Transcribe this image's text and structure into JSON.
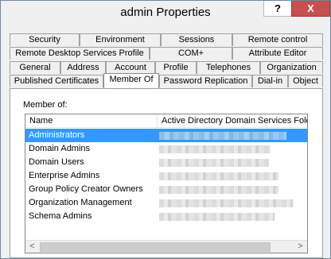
{
  "window": {
    "title": "admin Properties",
    "help_label": "?",
    "close_label": "X"
  },
  "tabs": {
    "row1": [
      "Security",
      "Environment",
      "Sessions",
      "Remote control"
    ],
    "row2": [
      "Remote Desktop Services Profile",
      "COM+",
      "Attribute Editor"
    ],
    "row3": [
      "General",
      "Address",
      "Account",
      "Profile",
      "Telephones",
      "Organization"
    ],
    "row4": [
      "Published Certificates",
      "Member Of",
      "Password Replication",
      "Dial-in",
      "Object"
    ],
    "active": "Member Of"
  },
  "member_of": {
    "label": "Member of:",
    "columns": [
      "Name",
      "Active Directory Domain Services Folder"
    ],
    "rows": [
      {
        "name": "Administrators",
        "selected": true
      },
      {
        "name": "Domain Admins",
        "selected": false
      },
      {
        "name": "Domain Users",
        "selected": false
      },
      {
        "name": "Enterprise Admins",
        "selected": false
      },
      {
        "name": "Group Policy Creator Owners",
        "selected": false
      },
      {
        "name": "Organization Management",
        "selected": false
      },
      {
        "name": "Schema Admins",
        "selected": false
      }
    ]
  },
  "scrollbar": {
    "left_icon": "left-arrow-icon",
    "right_icon": "right-arrow-icon",
    "left_glyph": "<",
    "right_glyph": ">"
  }
}
